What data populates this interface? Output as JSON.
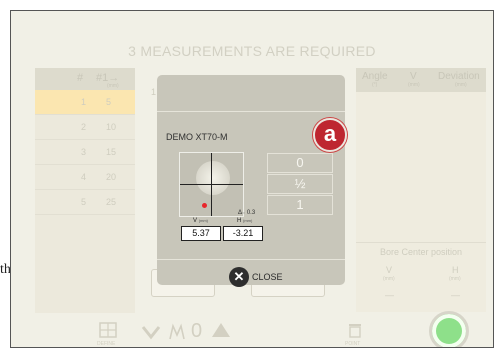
{
  "background_text": "th",
  "title": "3 MEASUREMENTS ARE REQUIRED",
  "left_table": {
    "headers": [
      "#",
      "#1→"
    ],
    "header_unit": "(mm)",
    "rows": [
      {
        "n": "1",
        "d": "5"
      },
      {
        "n": "2",
        "d": "10"
      },
      {
        "n": "3",
        "d": "15"
      },
      {
        "n": "4",
        "d": "20"
      },
      {
        "n": "5",
        "d": "25"
      }
    ]
  },
  "middle_label": "1",
  "right_table": {
    "headers": [
      "Angle",
      "V",
      "Deviation"
    ],
    "units": [
      "(°)",
      "(mm)",
      "(mm)"
    ]
  },
  "bore_center": {
    "title": "Bore Center position",
    "v_label": "V",
    "h_label": "H",
    "unit": "(mm)",
    "v_value": "—",
    "h_value": "—"
  },
  "toolbar": {
    "define_label": "DEFINE",
    "counter": "0",
    "point_label": "POINT"
  },
  "modal": {
    "device": "DEMO XT70-M",
    "badge": "a",
    "delta": "Δ₋ 0.3",
    "scale": [
      "0",
      "½",
      "1"
    ],
    "v_label": "V",
    "h_label": "H",
    "unit": "(mm)",
    "v_value": "5.37",
    "h_value": "-3.21",
    "close_label": "CLOSE"
  },
  "colors": {
    "badge": "#be2630",
    "measure_button": "#8ee08a",
    "selected_row": "#fbe6b0",
    "dot": "#e8262b"
  }
}
